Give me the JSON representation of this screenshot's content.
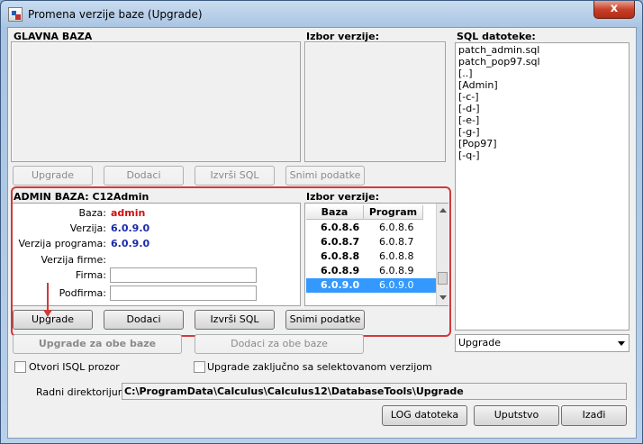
{
  "window": {
    "title": "Promena verzije baze (Upgrade)",
    "close_glyph": "x"
  },
  "main_db": {
    "title": "GLAVNA BAZA",
    "version_label": "Izbor verzije:",
    "buttons": {
      "upgrade": "Upgrade",
      "add": "Dodaci",
      "run_sql": "Izvrši SQL",
      "save": "Snimi podatke"
    }
  },
  "admin_db": {
    "title": "ADMIN BAZA: C12Admin",
    "version_label": "Izbor verzije:",
    "fields": {
      "baza_label": "Baza:",
      "baza_value": "admin",
      "verzija_label": "Verzija:",
      "verzija_value": "6.0.9.0",
      "verzija_programa_label": "Verzija programa:",
      "verzija_programa_value": "6.0.9.0",
      "verzija_firme_label": "Verzija firme:",
      "firma_label": "Firma:",
      "firma_value": "",
      "podfirma_label": "Podfirma:",
      "podfirma_value": ""
    },
    "table": {
      "headers": [
        "Baza",
        "Program"
      ],
      "rows": [
        {
          "baza": "6.0.8.6",
          "program": "6.0.8.6"
        },
        {
          "baza": "6.0.8.7",
          "program": "6.0.8.7"
        },
        {
          "baza": "6.0.8.8",
          "program": "6.0.8.8"
        },
        {
          "baza": "6.0.8.9",
          "program": "6.0.8.9"
        },
        {
          "baza": "6.0.9.0",
          "program": "6.0.9.0"
        }
      ],
      "selected_row": "6.0.9.0"
    },
    "buttons": {
      "upgrade": "Upgrade",
      "add": "Dodaci",
      "run_sql": "Izvrši SQL",
      "save": "Snimi podatke"
    }
  },
  "both": {
    "upgrade": "Upgrade za obe baze",
    "add": "Dodaci za obe baze"
  },
  "sql_files": {
    "title": "SQL datoteke:",
    "items": [
      "patch_admin.sql",
      "patch_pop97.sql",
      "[..]",
      "[Admin]",
      "[-c-]",
      "[-d-]",
      "[-e-]",
      "[-g-]",
      "[Pop97]",
      "[-q-]"
    ],
    "filter_value": "Upgrade"
  },
  "options": {
    "isql_label": "Otvori ISQL prozor",
    "finalize_label": "Upgrade zaključno sa selektovanom verzijom"
  },
  "workdir": {
    "label": "Radni direktorijum:",
    "value": "C:\\ProgramData\\Calculus\\Calculus12\\DatabaseTools\\Upgrade"
  },
  "footer": {
    "log": "LOG datoteka",
    "help": "Uputstvo",
    "exit": "Izađi"
  },
  "colors": {
    "highlight_outline": "#d03a3a",
    "selection": "#3399ff",
    "value_red": "#d01010",
    "value_blue": "#1a2aaa"
  }
}
